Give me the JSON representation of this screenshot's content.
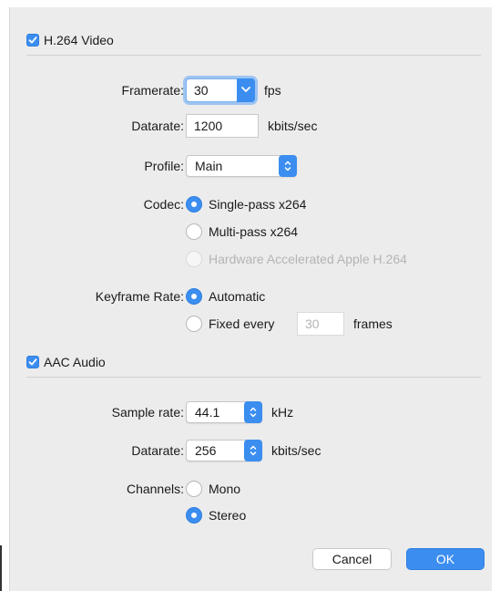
{
  "video": {
    "enable_label": "H.264 Video",
    "enabled": true,
    "framerate": {
      "label": "Framerate:",
      "value": "30",
      "unit": "fps"
    },
    "datarate": {
      "label": "Datarate:",
      "value": "1200",
      "unit": "kbits/sec"
    },
    "profile": {
      "label": "Profile:",
      "value": "Main"
    },
    "codec": {
      "label": "Codec:",
      "options": [
        "Single-pass x264",
        "Multi-pass x264",
        "Hardware Accelerated Apple H.264"
      ],
      "selected": "Single-pass x264",
      "disabled": [
        "Hardware Accelerated Apple H.264"
      ]
    },
    "keyframe": {
      "label": "Keyframe Rate:",
      "automatic_label": "Automatic",
      "fixed_label": "Fixed every",
      "fixed_value": "30",
      "fixed_unit": "frames",
      "selected": "Automatic"
    }
  },
  "audio": {
    "enable_label": "AAC Audio",
    "enabled": true,
    "sample_rate": {
      "label": "Sample rate:",
      "value": "44.1",
      "unit": "kHz"
    },
    "datarate": {
      "label": "Datarate:",
      "value": "256",
      "unit": "kbits/sec"
    },
    "channels": {
      "label": "Channels:",
      "options": [
        "Mono",
        "Stereo"
      ],
      "selected": "Stereo"
    }
  },
  "buttons": {
    "cancel": "Cancel",
    "ok": "OK"
  },
  "colors": {
    "accent": "#3b8ef0",
    "panel": "#ececec"
  },
  "icons": {
    "checkbox": "checkmark-icon",
    "combo": "chevron-down-icon",
    "popup": "up-down-arrows-icon"
  }
}
